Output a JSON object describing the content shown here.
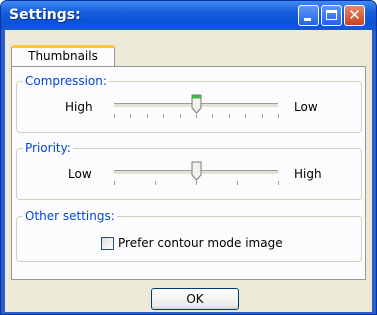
{
  "window": {
    "title": "Settings:"
  },
  "caption_buttons": {
    "minimize_icon": "minimize-icon",
    "maximize_icon": "maximize-icon",
    "close_icon": "close-icon",
    "close_glyph": "✕"
  },
  "tabs": [
    {
      "label": "Thumbnails",
      "selected": true
    }
  ],
  "compression": {
    "label": "Compression:",
    "left_label": "High",
    "right_label": "Low",
    "tick_count": 11,
    "value_fraction": 0.5
  },
  "priority": {
    "label": "Priority:",
    "left_label": "Low",
    "right_label": "High",
    "tick_count": 5,
    "value_fraction": 0.5
  },
  "other_settings": {
    "label": "Other settings:",
    "checkbox_label": "Prefer contour mode image",
    "checked": false
  },
  "ok_button": {
    "label": "OK"
  },
  "colors": {
    "title_bar": "#0a52d6",
    "dialog_bg": "#ece9d8",
    "group_label": "#0046d5",
    "tab_highlight": "#ffc83c"
  }
}
